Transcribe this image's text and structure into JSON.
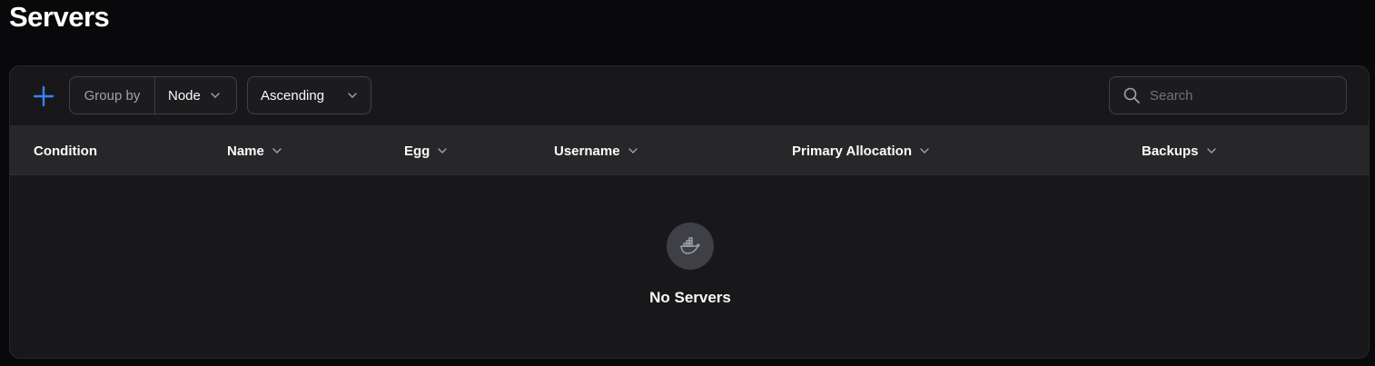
{
  "page": {
    "title": "Servers"
  },
  "toolbar": {
    "group_by_label": "Group by",
    "group_by_value": "Node",
    "sort_value": "Ascending",
    "search_placeholder": "Search"
  },
  "table": {
    "columns": [
      {
        "label": "Condition",
        "sortable": false
      },
      {
        "label": "Name",
        "sortable": true
      },
      {
        "label": "Egg",
        "sortable": true
      },
      {
        "label": "Username",
        "sortable": true
      },
      {
        "label": "Primary Allocation",
        "sortable": true
      },
      {
        "label": "Backups",
        "sortable": true
      }
    ],
    "rows": []
  },
  "empty_state": {
    "text": "No Servers",
    "icon": "docker-whale-icon"
  },
  "colors": {
    "accent": "#3b82f6",
    "background": "#09090b",
    "panel": "#18181b",
    "header": "#27272a"
  }
}
